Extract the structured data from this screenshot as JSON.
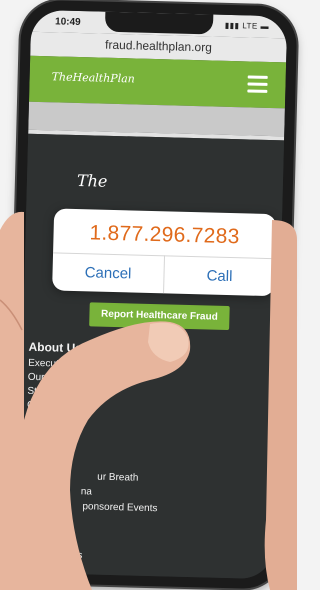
{
  "status": {
    "time": "10:49",
    "network": "LTE"
  },
  "browser": {
    "url": "fraud.healthplan.org"
  },
  "header": {
    "logo_text": "TheHealthPlan"
  },
  "footer": {
    "logo_text": "The"
  },
  "call_dialog": {
    "phone_number": "1.877.296.7283",
    "cancel_label": "Cancel",
    "call_label": "Call"
  },
  "cta": {
    "report_label": "Report Healthcare Fraud"
  },
  "footer_links": {
    "heading": "About Us",
    "items": [
      "Executive",
      "Our His",
      "Strat",
      "Ca"
    ],
    "more": [
      "ur Breath",
      "na",
      "ponsored Events",
      "ases"
    ]
  },
  "colors": {
    "brand_green": "#79b33a",
    "number_orange": "#e06a1b",
    "link_blue": "#2c6fb7",
    "footer_bg": "#2e3131"
  }
}
